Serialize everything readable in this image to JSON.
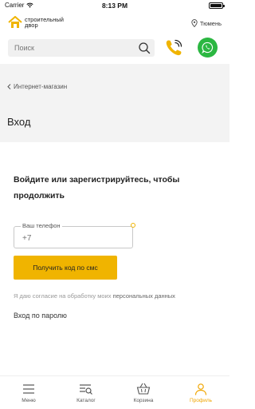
{
  "status_bar": {
    "carrier": "Carrier",
    "time": "8:13 PM"
  },
  "header": {
    "logo_line1": "строительный",
    "logo_line2": "двор",
    "city": "Тюмень"
  },
  "search": {
    "placeholder": "Поиск"
  },
  "breadcrumb": {
    "label": "Интернет-магазин"
  },
  "page": {
    "title": "Вход"
  },
  "login": {
    "prompt": "Войдите или зарегистрируйтесь, чтобы продолжить",
    "phone_label": "Ваш телефон",
    "phone_placeholder": "+7",
    "submit_label": "Получить код по смс",
    "consent_text": "Я даю согласие на обработку моих ",
    "consent_link": "персональных данных",
    "password_link": "Вход по паролю"
  },
  "tabs": [
    {
      "label": "Меню",
      "icon": "menu-icon",
      "active": false
    },
    {
      "label": "Каталог",
      "icon": "catalog-icon",
      "active": false
    },
    {
      "label": "Корзина",
      "icon": "basket-icon",
      "active": false
    },
    {
      "label": "Профиль",
      "icon": "profile-icon",
      "active": true
    }
  ],
  "colors": {
    "accent": "#f0b400",
    "whatsapp": "#2bb741",
    "tab_active": "#f0a500"
  }
}
